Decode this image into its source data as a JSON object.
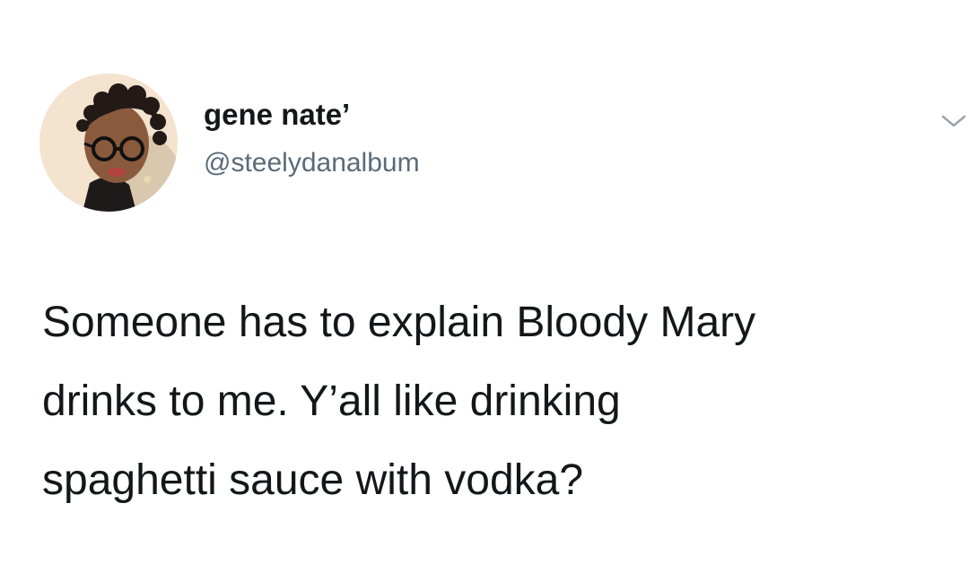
{
  "tweet": {
    "author": {
      "display_name": "gene nate’",
      "handle": "@steelydanalbum",
      "avatar_icon": "profile-photo"
    },
    "menu_icon": "chevron-down-icon",
    "text_lines": [
      "Someone has to explain Bloody Mary",
      "drinks to me. Y’all like drinking",
      "spaghetti sauce with vodka?"
    ],
    "colors": {
      "background": "#ffffff",
      "text": "#14171a",
      "secondary_text": "#5b6b78",
      "caret": "#9aa4ad"
    }
  }
}
